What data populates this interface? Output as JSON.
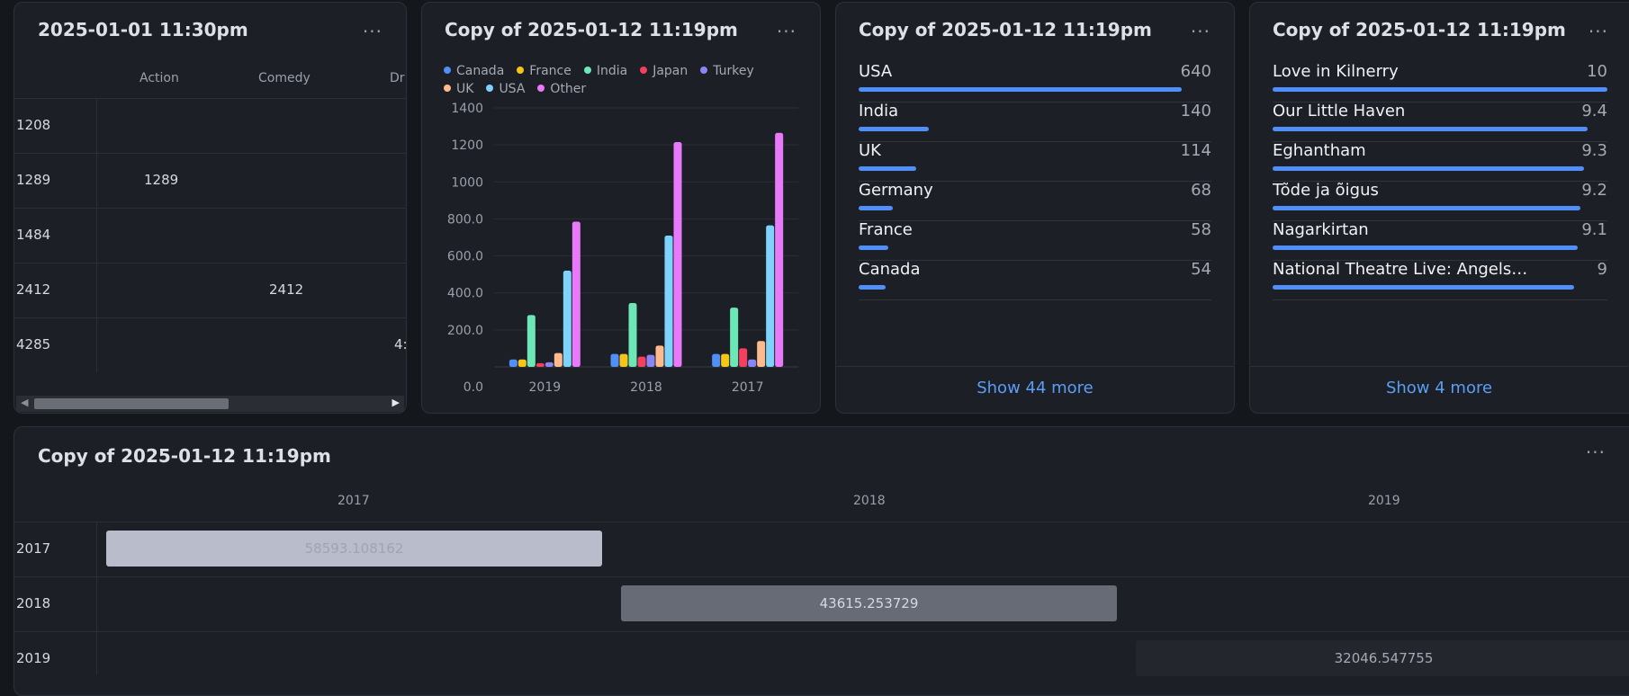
{
  "table_card": {
    "title": "2025-01-01 11:30pm",
    "menu": "···",
    "columns": [
      "Action",
      "Comedy",
      "Dr"
    ],
    "rows": [
      {
        "label": "1208",
        "cells": [
          "",
          "",
          ""
        ]
      },
      {
        "label": "1289",
        "cells": [
          "1289",
          "",
          ""
        ]
      },
      {
        "label": "1484",
        "cells": [
          "",
          "",
          ""
        ]
      },
      {
        "label": "2412",
        "cells": [
          "",
          "2412",
          ""
        ]
      },
      {
        "label": "4285",
        "cells": [
          "",
          "",
          "4:"
        ]
      }
    ]
  },
  "chart_card": {
    "title": "Copy of 2025-01-12 11:19pm",
    "menu": "···"
  },
  "chart_data": {
    "type": "bar",
    "categories": [
      "2019",
      "2018",
      "2017"
    ],
    "series": [
      {
        "name": "Canada",
        "color": "#4f8ff7",
        "values": [
          40,
          70,
          70
        ]
      },
      {
        "name": "France",
        "color": "#f5c518",
        "values": [
          40,
          70,
          70
        ]
      },
      {
        "name": "India",
        "color": "#6ee7b7",
        "values": [
          280,
          345,
          320
        ]
      },
      {
        "name": "Japan",
        "color": "#f43f5e",
        "values": [
          20,
          55,
          100
        ]
      },
      {
        "name": "Turkey",
        "color": "#8b84f7",
        "values": [
          25,
          65,
          40
        ]
      },
      {
        "name": "UK",
        "color": "#fdba8c",
        "values": [
          75,
          115,
          140
        ]
      },
      {
        "name": "USA",
        "color": "#7dd3fc",
        "values": [
          520,
          710,
          765
        ]
      },
      {
        "name": "Other",
        "color": "#e879f9",
        "values": [
          785,
          1215,
          1265
        ]
      }
    ],
    "yticks": [
      "0.0",
      "200.0",
      "400.0",
      "600.0",
      "800.0",
      "1000",
      "1200",
      "1400"
    ],
    "ylim": [
      0,
      1400
    ]
  },
  "country_card": {
    "title": "Copy of 2025-01-12 11:19pm",
    "menu": "···",
    "items": [
      {
        "label": "USA",
        "value": "640",
        "fraction": 0.915
      },
      {
        "label": "India",
        "value": "140",
        "fraction": 0.2
      },
      {
        "label": "UK",
        "value": "114",
        "fraction": 0.163
      },
      {
        "label": "Germany",
        "value": "68",
        "fraction": 0.097
      },
      {
        "label": "France",
        "value": "58",
        "fraction": 0.083
      },
      {
        "label": "Canada",
        "value": "54",
        "fraction": 0.077
      }
    ],
    "show_more": "Show 44 more"
  },
  "movie_card": {
    "title": "Copy of 2025-01-12 11:19pm",
    "menu": "···",
    "items": [
      {
        "label": "Love in Kilnerry",
        "value": "10",
        "fraction": 1.0
      },
      {
        "label": "Our Little Haven",
        "value": "9.4",
        "fraction": 0.94
      },
      {
        "label": "Eghantham",
        "value": "9.3",
        "fraction": 0.93
      },
      {
        "label": "Tõde ja õigus",
        "value": "9.2",
        "fraction": 0.92
      },
      {
        "label": "Nagarkirtan",
        "value": "9.1",
        "fraction": 0.91
      },
      {
        "label": "National Theatre Live: Angels in Americ...",
        "value": "9",
        "fraction": 0.9
      }
    ],
    "show_more": "Show 4 more"
  },
  "heat_card": {
    "title": "Copy of 2025-01-12 11:19pm",
    "menu": "···",
    "columns": [
      "2017",
      "2018",
      "2019"
    ],
    "rows": [
      {
        "label": "2017",
        "value": "58593.108162",
        "col": 0,
        "color": "#b9bccb",
        "text_color": "#9fa3b3"
      },
      {
        "label": "2018",
        "value": "43615.253729",
        "col": 1,
        "color": "#676b76",
        "text_color": "#d6d8de"
      },
      {
        "label": "2019",
        "value": "32046.547755",
        "col": 2,
        "color": "#23262d",
        "text_color": "#a4a9b3"
      }
    ]
  }
}
